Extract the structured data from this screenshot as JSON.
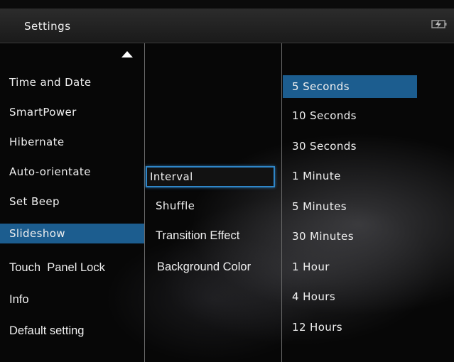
{
  "header": {
    "title": "Settings",
    "battery_icon": "battery-charging-icon"
  },
  "menu": {
    "scroll_up_icon": "triangle-up-icon",
    "items": [
      {
        "label": "Time and Date"
      },
      {
        "label": "SmartPower"
      },
      {
        "label": "Hibernate"
      },
      {
        "label": "Auto-orientate"
      },
      {
        "label": "Set Beep"
      },
      {
        "label": "Slideshow",
        "selected": true
      },
      {
        "label": "Touch  Panel Lock"
      },
      {
        "label": "Info"
      },
      {
        "label": "Default setting"
      }
    ]
  },
  "submenu": {
    "items": [
      {
        "label": "Interval",
        "focused": true
      },
      {
        "label": "Shuffle"
      },
      {
        "label": "Transition Effect"
      },
      {
        "label": "Background Color"
      }
    ]
  },
  "options": {
    "items": [
      {
        "label": "5 Seconds",
        "selected": true
      },
      {
        "label": "10 Seconds"
      },
      {
        "label": "30 Seconds"
      },
      {
        "label": "1 Minute"
      },
      {
        "label": "5 Minutes"
      },
      {
        "label": "30 Minutes"
      },
      {
        "label": "1 Hour"
      },
      {
        "label": "4 Hours"
      },
      {
        "label": "12 Hours"
      }
    ]
  },
  "colors": {
    "selection": "#1c5d8f",
    "focus_border": "#2f86c8",
    "titlebar": "#262626"
  }
}
